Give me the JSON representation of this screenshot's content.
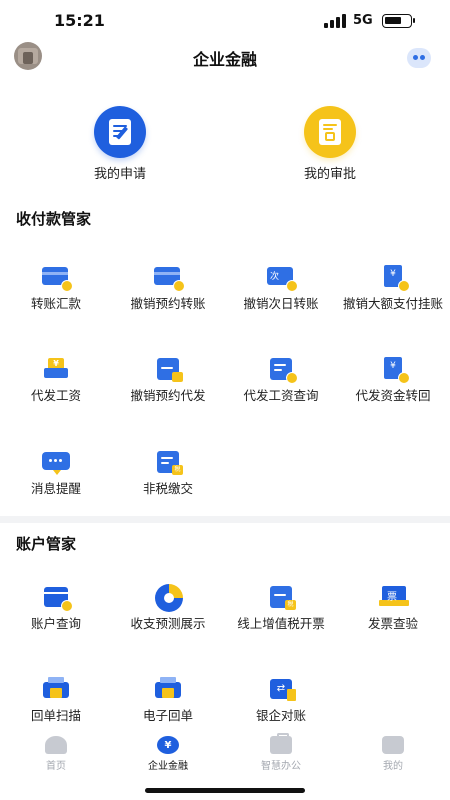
{
  "status_bar": {
    "time": "15:21",
    "network": "5G"
  },
  "header": {
    "title": "企业金融"
  },
  "quick_actions": [
    {
      "label": "我的申请",
      "icon": "application-doc-icon",
      "color": "#1f5fde"
    },
    {
      "label": "我的审批",
      "icon": "approval-doc-icon",
      "color": "#f5c31a"
    }
  ],
  "payments": {
    "title": "收付款管家",
    "items": [
      {
        "label": "转账汇款",
        "icon": "transfer-card-icon"
      },
      {
        "label": "撤销预约转账",
        "icon": "cancel-scheduled-transfer-icon"
      },
      {
        "label": "撤销次日转账",
        "icon": "cancel-next-day-transfer-icon",
        "icon_text": "次"
      },
      {
        "label": "撤销大额支付挂账",
        "icon": "cancel-large-payment-icon",
        "icon_text": "¥"
      },
      {
        "label": "代发工资",
        "icon": "payroll-icon",
        "icon_text": "¥"
      },
      {
        "label": "撤销预约代发",
        "icon": "cancel-scheduled-payroll-icon"
      },
      {
        "label": "代发工资查询",
        "icon": "payroll-query-icon"
      },
      {
        "label": "代发资金转回",
        "icon": "payroll-refund-icon",
        "icon_text": "¥"
      },
      {
        "label": "消息提醒",
        "icon": "message-icon"
      },
      {
        "label": "非税缴交",
        "icon": "non-tax-payment-icon",
        "icon_text": "税"
      }
    ]
  },
  "accounts": {
    "title": "账户管家",
    "items": [
      {
        "label": "账户查询",
        "icon": "account-query-icon"
      },
      {
        "label": "收支预测展示",
        "icon": "forecast-pie-icon"
      },
      {
        "label": "线上增值税开票",
        "icon": "vat-invoice-icon",
        "icon_text": "税"
      },
      {
        "label": "发票查验",
        "icon": "invoice-check-icon",
        "icon_text": "票"
      },
      {
        "label": "回单扫描",
        "icon": "receipt-scan-icon"
      },
      {
        "label": "电子回单",
        "icon": "e-receipt-icon"
      },
      {
        "label": "银企对账",
        "icon": "reconciliation-icon",
        "icon_text": "⇄"
      }
    ]
  },
  "tabbar": {
    "items": [
      {
        "label": "首页",
        "active": false
      },
      {
        "label": "企业金融",
        "active": true,
        "icon_text": "¥"
      },
      {
        "label": "智慧办公",
        "active": false
      },
      {
        "label": "我的",
        "active": false
      }
    ]
  },
  "colors": {
    "primary": "#1f5fde",
    "accent": "#f5c31a",
    "divider": "#f2f3f5"
  }
}
